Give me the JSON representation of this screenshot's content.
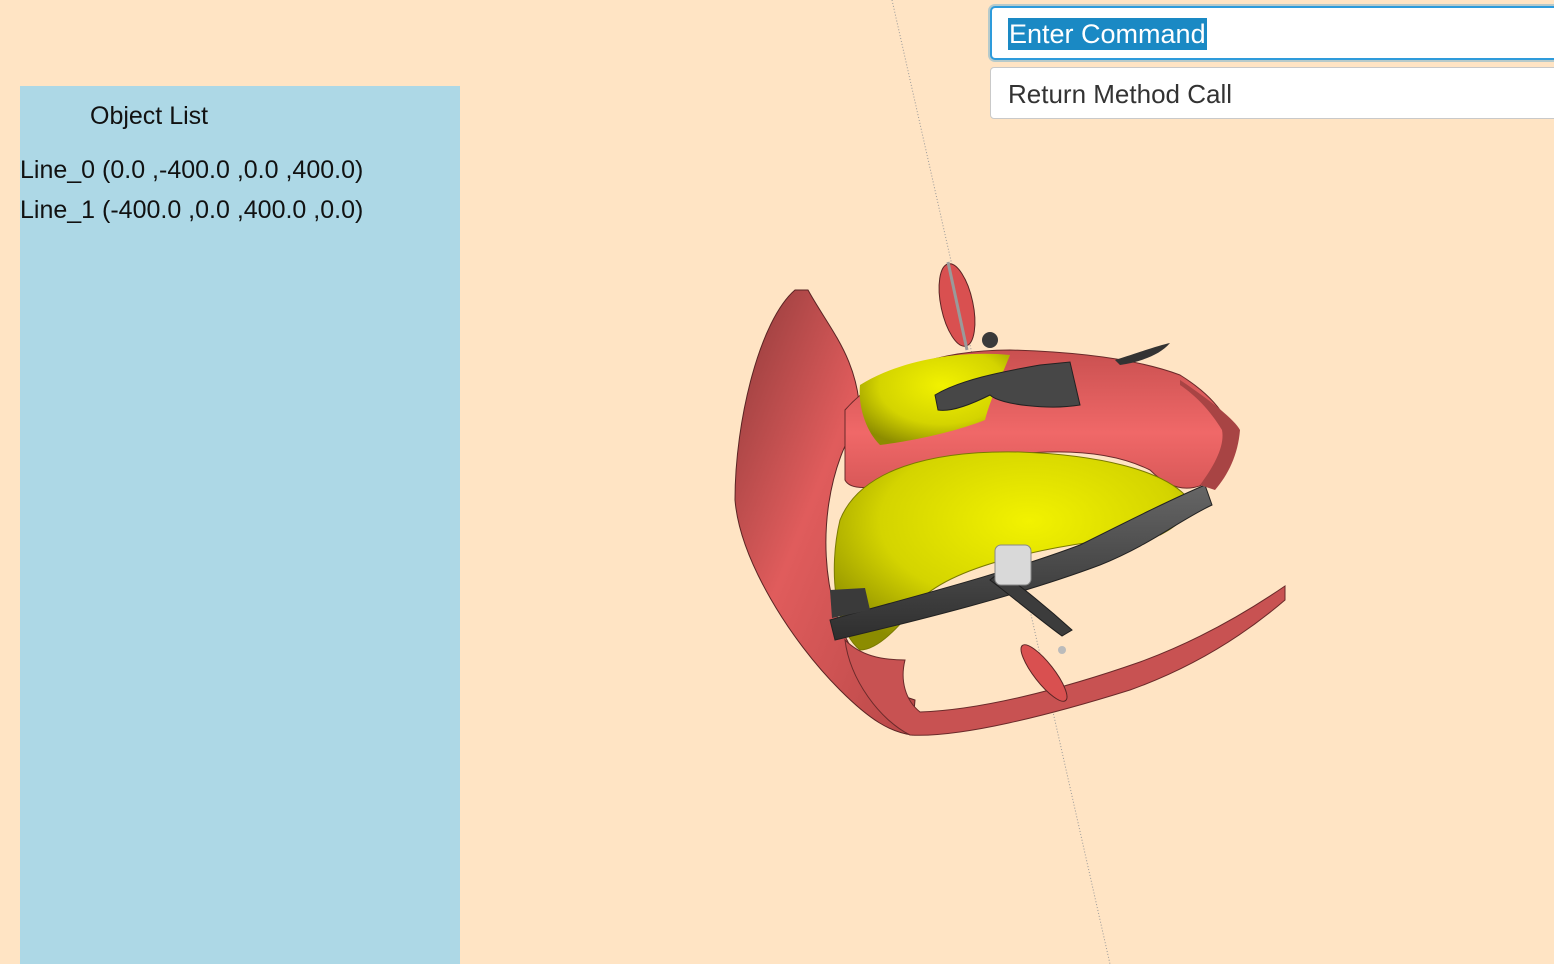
{
  "object_panel": {
    "title": "Object List",
    "items": [
      {
        "label": "Line_0 (0.0 ,-400.0 ,0.0 ,400.0)"
      },
      {
        "label": "Line_1 (-400.0 ,0.0 ,400.0 ,0.0)"
      }
    ]
  },
  "command": {
    "value": "Enter Command",
    "selected": true
  },
  "output": {
    "value": "Return Method Call"
  },
  "colors": {
    "background": "#FFE4C4",
    "panel": "#ADD8E6",
    "model_shell": "#E06060",
    "model_inner": "#D4D400",
    "model_parts": "#4A4A4A",
    "selection": "#1A89C4"
  }
}
